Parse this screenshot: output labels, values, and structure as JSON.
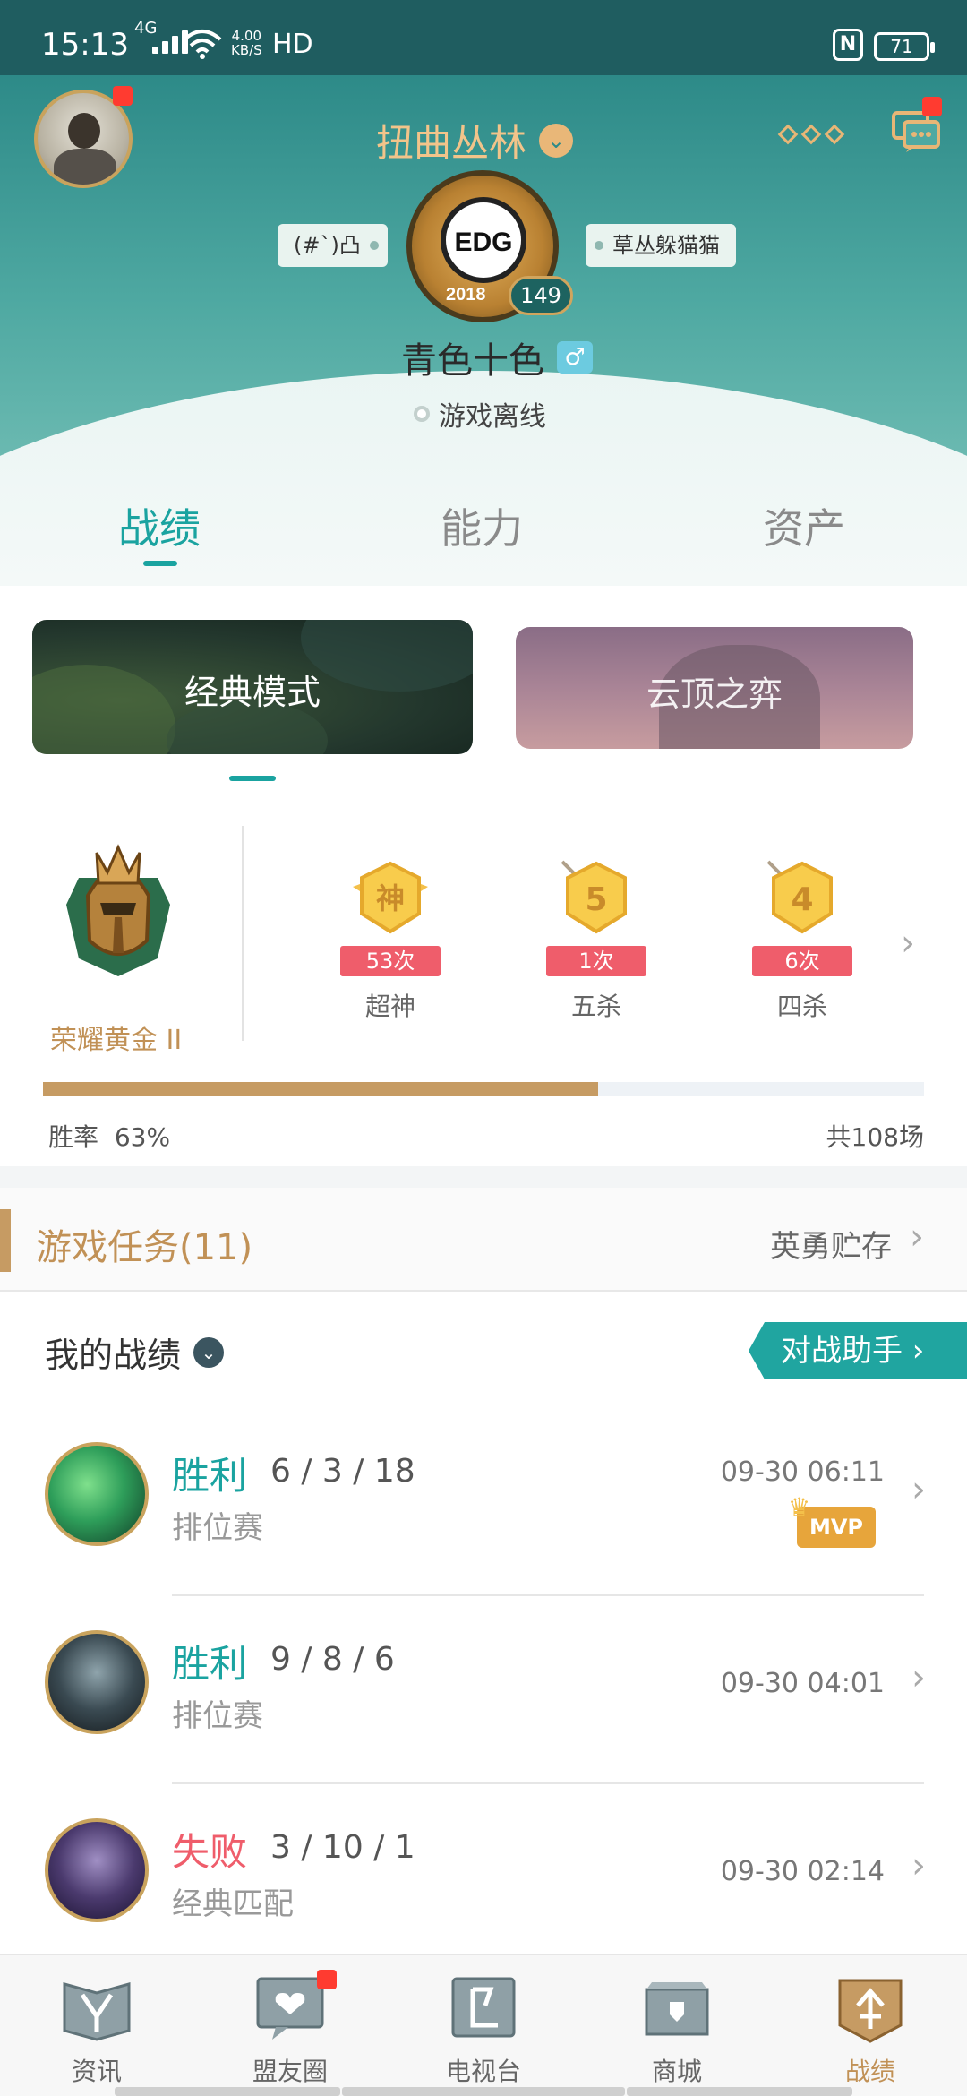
{
  "status_bar": {
    "time": "15:13",
    "network": "4G",
    "speed_value": "4.00",
    "speed_unit": "KB/S",
    "hd": "HD",
    "nfc": "N",
    "battery": "71"
  },
  "profile": {
    "server_name": "扭曲丛林",
    "clan_tag_left": "(#`)凸",
    "clan_tag_right": "草丛躲猫猫",
    "clan_logo_text": "EDG",
    "clan_logo_year": "2018",
    "level": "149",
    "player_name": "青色十色",
    "gender_symbol": "♂",
    "status": "游戏离线"
  },
  "tabs": [
    {
      "label": "战绩",
      "active": true
    },
    {
      "label": "能力",
      "active": false
    },
    {
      "label": "资产",
      "active": false
    }
  ],
  "modes": {
    "classic": "经典模式",
    "tft": "云顶之弈"
  },
  "rank": {
    "name": "荣耀黄金 II"
  },
  "honors": [
    {
      "glyph": "神",
      "count": "53次",
      "label": "超神"
    },
    {
      "glyph": "5",
      "count": "1次",
      "label": "五杀"
    },
    {
      "glyph": "4",
      "count": "6次",
      "label": "四杀"
    }
  ],
  "stats": {
    "win_rate_label": "胜率",
    "win_rate_value": "63%",
    "win_rate_fraction": 0.63,
    "total": "共108场"
  },
  "tasks": {
    "title": "游戏任务(11)",
    "link": "英勇贮存"
  },
  "records": {
    "title": "我的战绩",
    "assistant": "对战助手 ›",
    "matches": [
      {
        "result": "胜利",
        "outcome": "win",
        "kda": "6 / 3 / 18",
        "mode": "排位赛",
        "time": "09-30 06:11",
        "mvp": "MVP",
        "hero_color": "#2e9e5a"
      },
      {
        "result": "胜利",
        "outcome": "win",
        "kda": "9 / 8 / 6",
        "mode": "排位赛",
        "time": "09-30 04:01",
        "mvp": "",
        "hero_color": "#3a4a52"
      },
      {
        "result": "失败",
        "outcome": "loss",
        "kda": "3 / 10 / 1",
        "mode": "经典匹配",
        "time": "09-30 02:14",
        "mvp": "",
        "hero_color": "#4b3a6e"
      }
    ]
  },
  "bottom_nav": [
    {
      "label": "资讯",
      "icon": "news-icon",
      "active": false
    },
    {
      "label": "盟友圈",
      "icon": "friends-circle-icon",
      "active": false
    },
    {
      "label": "电视台",
      "icon": "tv-icon",
      "active": false
    },
    {
      "label": "商城",
      "icon": "shop-icon",
      "active": false
    },
    {
      "label": "战绩",
      "icon": "records-icon",
      "active": true
    }
  ],
  "colors": {
    "teal": "#1aa3a0",
    "gold": "#c19156",
    "loss_red": "#ef5d6b"
  }
}
